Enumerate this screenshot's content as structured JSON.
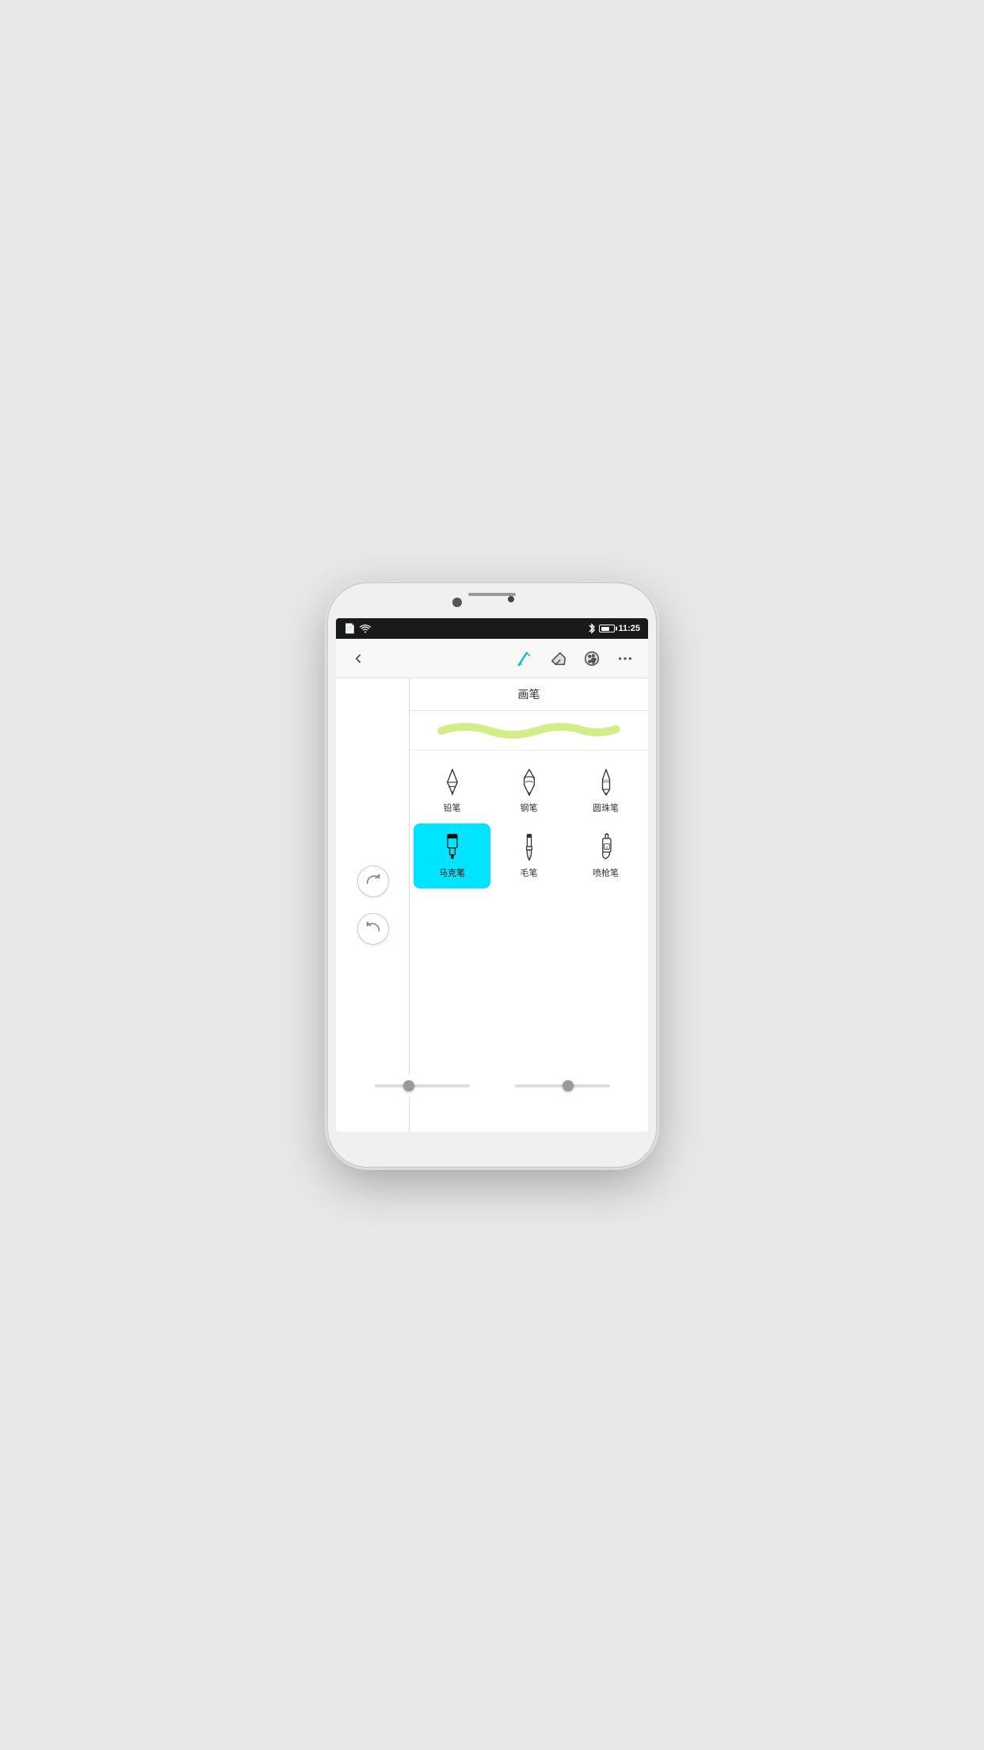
{
  "status_bar": {
    "time": "11:25",
    "bluetooth_label": "BT",
    "battery_label": "Battery"
  },
  "toolbar": {
    "back_label": "Back",
    "brush_label": "Brush",
    "eraser_label": "Eraser",
    "palette_label": "Palette",
    "more_label": "More"
  },
  "panel": {
    "title": "画笔",
    "stroke_preview": "wavy stroke preview"
  },
  "tools": [
    {
      "id": "pencil",
      "label": "铅笔",
      "active": false
    },
    {
      "id": "pen",
      "label": "钢笔",
      "active": false
    },
    {
      "id": "ballpen",
      "label": "圆珠笔",
      "active": false
    },
    {
      "id": "marker",
      "label": "马克笔",
      "active": true
    },
    {
      "id": "brush",
      "label": "毛笔",
      "active": false
    },
    {
      "id": "spray",
      "label": "喷枪笔",
      "active": false
    }
  ],
  "actions": {
    "redo_label": "Redo",
    "undo_label": "Undo"
  },
  "sliders": {
    "slider1_label": "Size",
    "slider2_label": "Opacity"
  }
}
